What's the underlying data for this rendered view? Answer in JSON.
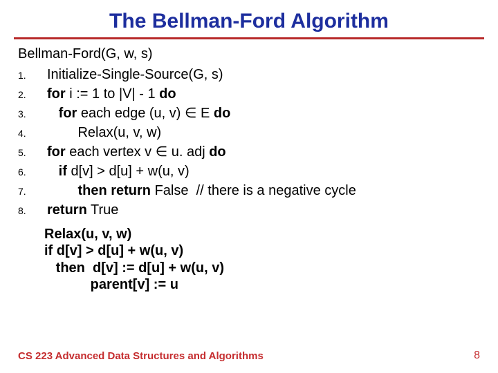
{
  "title": "The Bellman-Ford Algorithm",
  "fn_head": "Bellman-Ford(G, w, s)",
  "lines": [
    {
      "n": "1.",
      "t": "Initialize-Single-Source(G, s)"
    },
    {
      "n": "2.",
      "t": "<span class=\"b\">for</span> i := 1 to |V| - 1 <span class=\"b\">do</span>"
    },
    {
      "n": "3.",
      "t": "   <span class=\"b\">for</span> each edge (u, v) ∈ E <span class=\"b\">do</span>"
    },
    {
      "n": "4.",
      "t": "        Relax(u, v, w)"
    },
    {
      "n": "5.",
      "t": "<span class=\"b\">for</span> each vertex v ∈ u. adj <span class=\"b\">do</span>"
    },
    {
      "n": "6.",
      "t": "   <span class=\"b\">if</span> d[v] > d[u] + w(u, v)"
    },
    {
      "n": "7.",
      "t": "        <span class=\"b\">then return</span> False  // there is a negative cycle"
    },
    {
      "n": "8.",
      "t": "<span class=\"b\">return</span> True"
    }
  ],
  "relax": "Relax(u, v, w)\nif d[v] > d[u] + w(u, v)\n   then  d[v] := d[u] + w(u, v)\n            parent[v] := u",
  "footer": "CS 223 Advanced Data Structures and Algorithms",
  "page": "8"
}
